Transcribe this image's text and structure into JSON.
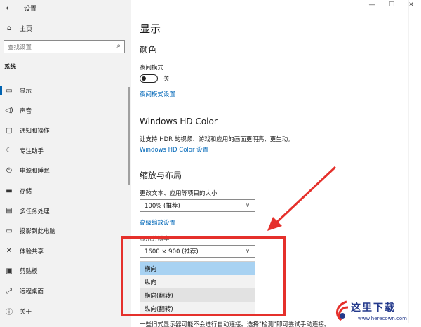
{
  "window": {
    "title": "设置",
    "controls": [
      "—",
      "☐",
      "✕"
    ]
  },
  "sidebar": {
    "home": "主页",
    "search_placeholder": "查找设置",
    "section": "系统",
    "items": [
      {
        "icon": "monitor-icon",
        "glyph": "▭",
        "label": "显示",
        "active": true
      },
      {
        "icon": "speaker-icon",
        "glyph": "◁)",
        "label": "声音",
        "active": false
      },
      {
        "icon": "notification-icon",
        "glyph": "▢",
        "label": "通知和操作",
        "active": false
      },
      {
        "icon": "moon-icon",
        "glyph": "☾",
        "label": "专注助手",
        "active": false
      },
      {
        "icon": "power-icon",
        "glyph": "⏻",
        "label": "电源和睡眠",
        "active": false
      },
      {
        "icon": "storage-icon",
        "glyph": "▬",
        "label": "存储",
        "active": false
      },
      {
        "icon": "multitask-icon",
        "glyph": "▤",
        "label": "多任务处理",
        "active": false
      },
      {
        "icon": "project-icon",
        "glyph": "▭",
        "label": "投影到此电脑",
        "active": false
      },
      {
        "icon": "share-icon",
        "glyph": "✕",
        "label": "体验共享",
        "active": false
      },
      {
        "icon": "clipboard-icon",
        "glyph": "▣",
        "label": "剪贴板",
        "active": false
      },
      {
        "icon": "remote-icon",
        "glyph": "⤢",
        "label": "远程桌面",
        "active": false
      },
      {
        "icon": "info-icon",
        "glyph": "ⓘ",
        "label": "关于",
        "active": false
      }
    ]
  },
  "main": {
    "title": "显示",
    "color_heading": "颜色",
    "night_mode_label": "夜间模式",
    "night_mode_state": "关",
    "night_mode_link": "夜间模式设置",
    "hdr_heading": "Windows HD Color",
    "hdr_desc": "让支持 HDR 的视频、游戏和应用的画面更明亮、更生动。",
    "hdr_link": "Windows HD Color 设置",
    "scale_heading": "缩放与布局",
    "scale_label": "更改文本、应用等项目的大小",
    "scale_value": "100% (推荐)",
    "advanced_scale_link": "高级缩放设置",
    "resolution_label": "显示分辨率",
    "resolution_value": "1600 × 900 (推荐)",
    "orientation_options": [
      "横向",
      "纵向",
      "横向(翻转)",
      "纵向(翻转)"
    ],
    "footer_text": "一些旧式显示器可能不会进行自动连接。选择\"检测\"即可尝试手动连接。"
  },
  "watermark": {
    "text": "这里下载",
    "url": "www.herecown.com"
  },
  "colors": {
    "accent": "#0067b8",
    "highlight": "#e5302b",
    "selected": "#a8d2f2"
  }
}
